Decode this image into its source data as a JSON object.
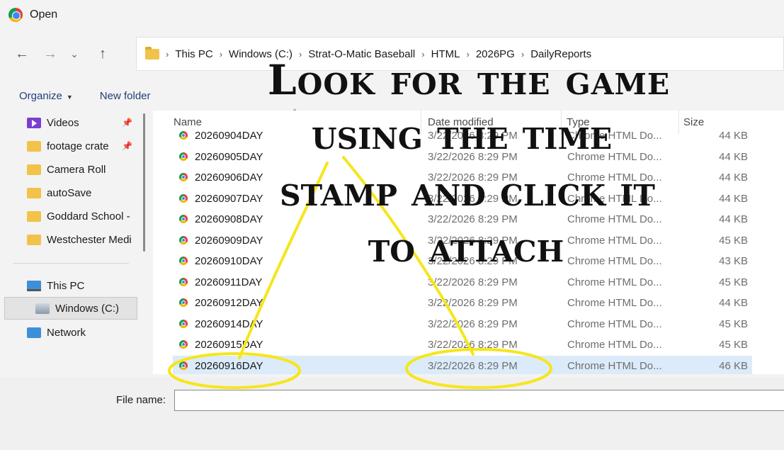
{
  "window": {
    "title": "Open"
  },
  "addressbar": {
    "crumbs": [
      "This PC",
      "Windows (C:)",
      "Strat-O-Matic Baseball",
      "HTML",
      "2026PG",
      "DailyReports"
    ]
  },
  "toolbar": {
    "organize": "Organize",
    "new_folder": "New folder"
  },
  "sidebar": {
    "items": [
      {
        "label": "Videos",
        "icon": "videos-icon"
      },
      {
        "label": "footage crate",
        "icon": "folder-icon"
      },
      {
        "label": "Camera Roll",
        "icon": "folder-icon"
      },
      {
        "label": "autoSave",
        "icon": "folder-icon"
      },
      {
        "label": "Goddard School -",
        "icon": "folder-icon"
      },
      {
        "label": "Westchester Medi",
        "icon": "folder-icon"
      },
      {
        "label": "This PC",
        "icon": "computer-icon"
      },
      {
        "label": "Windows (C:)",
        "icon": "drive-icon"
      },
      {
        "label": "Network",
        "icon": "network-icon"
      }
    ]
  },
  "columns": {
    "name": "Name",
    "date": "Date modified",
    "type": "Type",
    "size": "Size"
  },
  "files": [
    {
      "name": "20260904DAY",
      "date": "3/22/2026 8:29 PM",
      "type": "Chrome HTML Do...",
      "size": "44 KB"
    },
    {
      "name": "20260905DAY",
      "date": "3/22/2026 8:29 PM",
      "type": "Chrome HTML Do...",
      "size": "44 KB"
    },
    {
      "name": "20260906DAY",
      "date": "3/22/2026 8:29 PM",
      "type": "Chrome HTML Do...",
      "size": "44 KB"
    },
    {
      "name": "20260907DAY",
      "date": "3/22/2026 8:29 PM",
      "type": "Chrome HTML Do...",
      "size": "44 KB"
    },
    {
      "name": "20260908DAY",
      "date": "3/22/2026 8:29 PM",
      "type": "Chrome HTML Do...",
      "size": "44 KB"
    },
    {
      "name": "20260909DAY",
      "date": "3/22/2026 8:29 PM",
      "type": "Chrome HTML Do...",
      "size": "45 KB"
    },
    {
      "name": "20260910DAY",
      "date": "3/22/2026 8:29 PM",
      "type": "Chrome HTML Do...",
      "size": "43 KB"
    },
    {
      "name": "20260911DAY",
      "date": "3/22/2026 8:29 PM",
      "type": "Chrome HTML Do...",
      "size": "45 KB"
    },
    {
      "name": "20260912DAY",
      "date": "3/22/2026 8:29 PM",
      "type": "Chrome HTML Do...",
      "size": "44 KB"
    },
    {
      "name": "20260914DAY",
      "date": "3/22/2026 8:29 PM",
      "type": "Chrome HTML Do...",
      "size": "45 KB"
    },
    {
      "name": "20260915DAY",
      "date": "3/22/2026 8:29 PM",
      "type": "Chrome HTML Do...",
      "size": "45 KB"
    },
    {
      "name": "20260916DAY",
      "date": "3/22/2026 8:29 PM",
      "type": "Chrome HTML Do...",
      "size": "46 KB"
    }
  ],
  "filename": {
    "label": "File name:",
    "value": ""
  },
  "annotation": {
    "lines": [
      "Look for the game",
      "using the time",
      "stamp and click it",
      "to attach"
    ],
    "color": "#f5e61c"
  }
}
